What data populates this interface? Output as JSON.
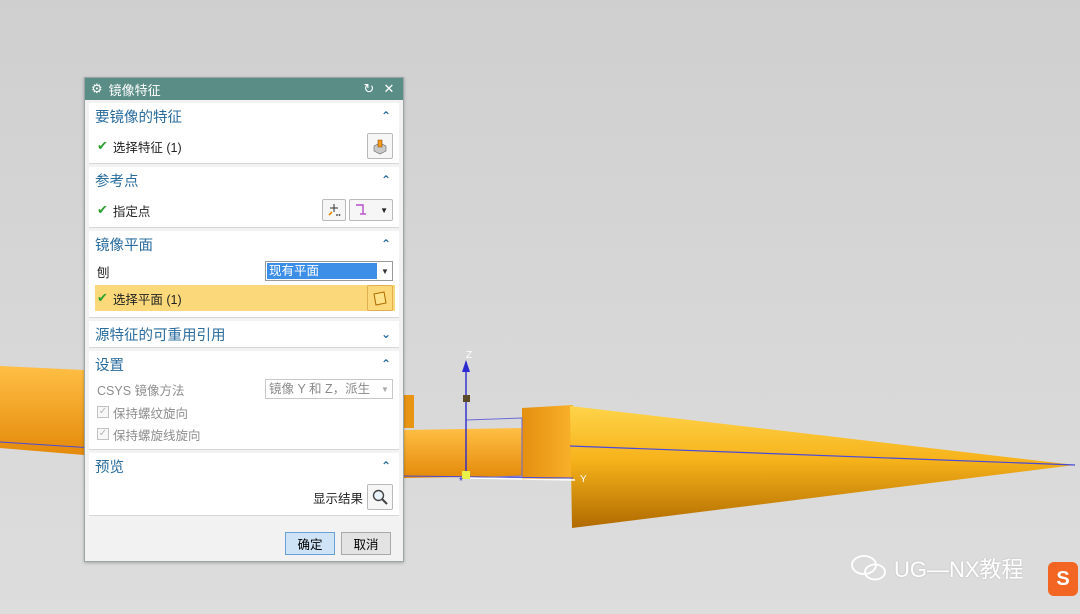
{
  "dialog": {
    "title": "镜像特征",
    "icons": {
      "gear": "gear-icon",
      "reset": "reset-icon",
      "close": "close-icon"
    }
  },
  "groups": {
    "features": {
      "title": "要镜像的特征",
      "select_label": "选择特征 (1)"
    },
    "refpoint": {
      "title": "参考点",
      "specify_label": "指定点"
    },
    "plane": {
      "title": "镜像平面",
      "plane_type_label": "刨",
      "plane_type_value": "现有平面",
      "select_label": "选择平面 (1)"
    },
    "reuse": {
      "title": "源特征的可重用引用"
    },
    "settings": {
      "title": "设置",
      "csys_label": "CSYS 镜像方法",
      "csys_value": "镜像 Y 和 Z，派生",
      "keep_thread": "保持螺纹旋向",
      "keep_helix": "保持螺旋线旋向"
    },
    "preview": {
      "title": "预览",
      "show_result": "显示结果"
    }
  },
  "buttons": {
    "ok": "确定",
    "cancel": "取消"
  },
  "viewport": {
    "axis_z": "Z",
    "axis_y": "Y",
    "model_color": "#f5a612"
  },
  "watermark": {
    "text": "UG—NX教程",
    "logo": "S"
  }
}
